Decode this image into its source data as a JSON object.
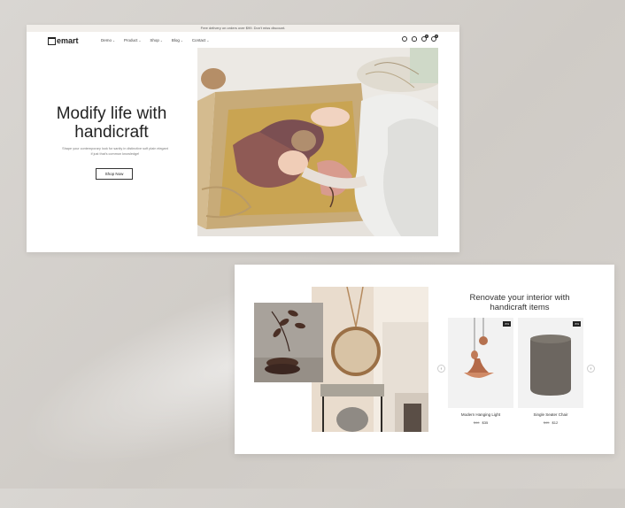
{
  "topbar": {
    "announcement": "Free delivery on orders over $99. Don't miss discount."
  },
  "brand": {
    "logo_text": "emart"
  },
  "nav": {
    "items": [
      {
        "label": "Demo",
        "chevron": "⌄"
      },
      {
        "label": "Product",
        "chevron": "⌄"
      },
      {
        "label": "Shop",
        "chevron": "⌄"
      },
      {
        "label": "Blog",
        "chevron": "⌄"
      },
      {
        "label": "Contact",
        "chevron": "⌄"
      }
    ],
    "icons": [
      "search-icon",
      "user-icon",
      "wishlist-icon",
      "cart-icon"
    ],
    "wishlist_count": "0",
    "cart_count": "0"
  },
  "hero": {
    "title_line1": "Modify life with",
    "title_line2": "handicraft",
    "subtitle": "Shape your contemporary look for sanity in distinctive soft plain elegant if just that's common knowledge!",
    "button_label": "Shop Now"
  },
  "section2": {
    "title_line1": "Renovate your interior with",
    "title_line2": "handicraft items",
    "products": [
      {
        "name": "Modern Hanging Light",
        "old_price": "$46",
        "price": "$35",
        "badge": "-5%"
      },
      {
        "name": "Single Seater Chair",
        "old_price": "$45",
        "price": "$12",
        "badge": "-5%"
      }
    ],
    "prev_arrow": "‹",
    "next_arrow": "›"
  },
  "colors": {
    "accent": "#222222",
    "page_bg": "#d9d6d2",
    "product_bg": "#f2f2f2"
  }
}
